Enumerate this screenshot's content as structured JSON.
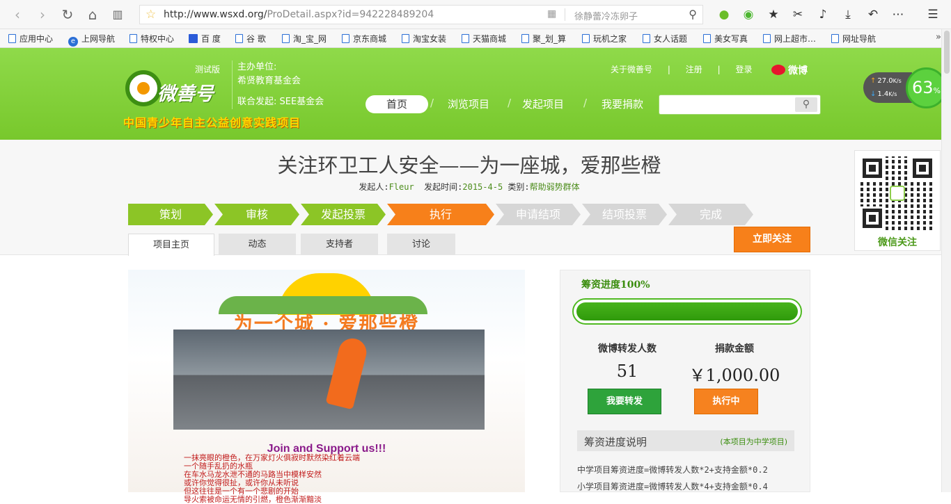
{
  "browser": {
    "url_host": "http://www.wsxd.org/",
    "url_path": "ProDetail.aspx?id=942228489204",
    "search_query": "徐静蕾冷冻卵子",
    "bookmarks": [
      "应用中心",
      "上网导航",
      "特权中心",
      "百 度",
      "谷 歌",
      "淘_宝_网",
      "京东商城",
      "淘宝女装",
      "天猫商城",
      "聚_划_算",
      "玩机之家",
      "女人话题",
      "美女写真",
      "网上超市…",
      "网址导航"
    ],
    "upload_speed": "27.0",
    "download_speed": "1.4",
    "speed_unit": "K/s",
    "memory_percent": "63",
    "percent_sign": "%"
  },
  "site": {
    "logo_text": "微善号",
    "beta_label": "测试版",
    "slogan": "中国青少年自主公益创意实践项目",
    "org_label": "主办单位:",
    "org_name": "希贤教育基金会",
    "co_label": "联合发起: SEE基金会",
    "top_links": [
      "关于微善号",
      "|",
      "注册",
      "|",
      "登录"
    ],
    "weibo_label": "微博",
    "nav": [
      "首页",
      "浏览项目",
      "发起项目",
      "我要捐款"
    ],
    "nav_sep": "/"
  },
  "project": {
    "title": "关注环卫工人安全——为一座城，爱那些橙",
    "initiator_label": "发起人:",
    "initiator": "Fleur",
    "date_label": "发起时间:",
    "date": "2015-4-5",
    "category_label": "类别:",
    "category": "帮助弱势群体",
    "steps": [
      {
        "label": "策划",
        "state": "done"
      },
      {
        "label": "审核",
        "state": "done"
      },
      {
        "label": "发起投票",
        "state": "done"
      },
      {
        "label": "执行",
        "state": "current"
      },
      {
        "label": "申请结项",
        "state": "todo"
      },
      {
        "label": "结项投票",
        "state": "todo"
      },
      {
        "label": "完成",
        "state": "todo"
      }
    ],
    "tabs": [
      "项目主页",
      "动态",
      "支持者",
      "讨论"
    ],
    "follow_button": "立即关注",
    "qr_label": "微信关注"
  },
  "poster": {
    "heading": "为一个城 · 爱那些橙",
    "join_text": "Join and Support us!!!",
    "lines": [
      "一抹亮眼的橙色，在万家灯火俱寂时默然染红着云端",
      "一个随手乱扔的水瓶",
      "在车水马龙水泄不通的马路当中模样安然",
      "或许你觉得很扯，或许你从未听说",
      "但这往往是一个有一个悲剧的开始",
      "导火索被命运无情的引燃，橙色渐渐黯淡"
    ]
  },
  "funding": {
    "progress_label": "筹资进度100%",
    "progress": 1.0,
    "weibo_label": "微博转发人数",
    "weibo_value": "51",
    "amount_label": "捐款金额",
    "amount_value": "￥1,000.00",
    "repost_button": "我要转发",
    "status_button": "执行中",
    "explain_title": "筹资进度说明",
    "explain_note": "(本项目为中学项目)",
    "formula_middle": "中学项目筹资进度=微博转发人数*2+支持金额*0.2",
    "formula_primary": "小学项目筹资进度=微博转发人数*4+支持金额*0.4"
  }
}
